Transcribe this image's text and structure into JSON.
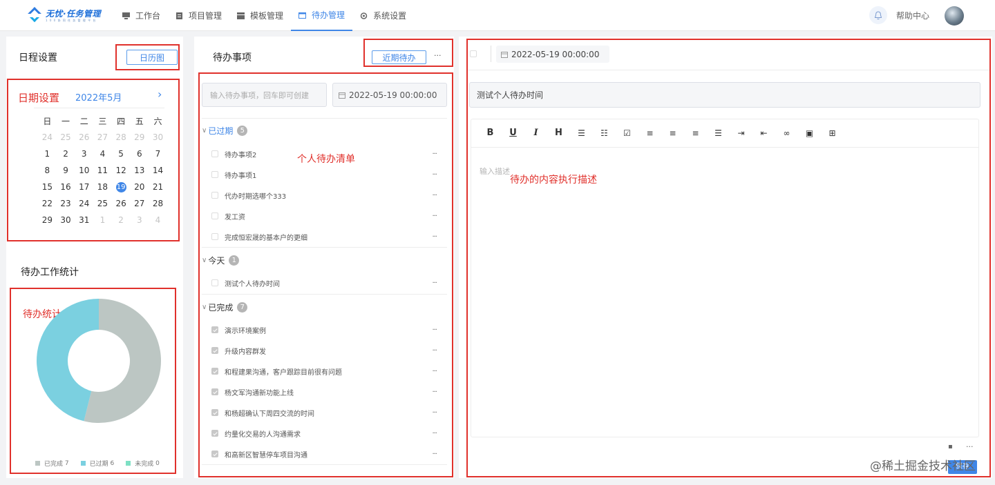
{
  "brand": {
    "title": "无忧·任务管理",
    "subtitle": "1 0 0 协 同 任 务 管 理 平 台"
  },
  "nav": {
    "items": [
      {
        "label": "工作台"
      },
      {
        "label": "项目管理"
      },
      {
        "label": "模板管理"
      },
      {
        "label": "待办管理",
        "active": true
      },
      {
        "label": "系统设置"
      }
    ]
  },
  "header": {
    "help": "帮助中心"
  },
  "schedule": {
    "title": "日程设置",
    "calendar_btn": "日历图",
    "annotation": "日期设置",
    "month": "2022年5月",
    "weekdays": [
      "日",
      "一",
      "二",
      "三",
      "四",
      "五",
      "六"
    ],
    "weeks": [
      [
        "24",
        "25",
        "26",
        "27",
        "28",
        "29",
        "30"
      ],
      [
        "1",
        "2",
        "3",
        "4",
        "5",
        "6",
        "7"
      ],
      [
        "8",
        "9",
        "10",
        "11",
        "12",
        "13",
        "14"
      ],
      [
        "15",
        "16",
        "17",
        "18",
        "19",
        "20",
        "21"
      ],
      [
        "22",
        "23",
        "24",
        "25",
        "26",
        "27",
        "28"
      ],
      [
        "29",
        "30",
        "31",
        "1",
        "2",
        "3",
        "4"
      ]
    ],
    "today": "19"
  },
  "stats": {
    "title": "待办工作统计",
    "annotation": "待办统计",
    "legend": [
      {
        "label": "已完成",
        "count": "7",
        "color": "#bcc6c3"
      },
      {
        "label": "已过期",
        "count": "6",
        "color": "#7bd0e0"
      },
      {
        "label": "未完成",
        "count": "0",
        "color": "#7ee0c4"
      }
    ]
  },
  "chart_data": {
    "type": "pie",
    "donut": true,
    "categories": [
      "已完成",
      "已过期",
      "未完成"
    ],
    "values": [
      7,
      6,
      0
    ],
    "colors": [
      "#bcc6c3",
      "#7bd0e0",
      "#7ee0c4"
    ],
    "legend": "bottom"
  },
  "todo": {
    "title": "待办事项",
    "recent_btn": "近期待办",
    "more": "···",
    "annotation": "个人待办清单",
    "input_placeholder": "输入待办事项，回车即可创建",
    "date_value": "2022-05-19 00:00:00",
    "groups": [
      {
        "name": "已过期",
        "count": "5",
        "items": [
          "待办事项2",
          "待办事项1",
          "代办时期选哪个333",
          "发工资",
          "完成恒宏晟的基本户的更细"
        ]
      },
      {
        "name": "今天",
        "count": "1",
        "items": [
          "测试个人待办时间"
        ]
      },
      {
        "name": "已完成",
        "count": "7",
        "items": [
          "演示环境案例",
          "升级内容群发",
          "和程建果沟通，客户跟踪目前很有问题",
          "杨文军沟通新功能上线",
          "和杨超确认下周四交流的时间",
          "约量化交易的人沟通需求",
          "和高新区智慧停车项目沟通"
        ]
      }
    ]
  },
  "detail": {
    "date_value": "2022-05-19 00:00:00",
    "title_value": "测试个人待办时间",
    "desc_placeholder": "输入描述",
    "annotation": "待办的内容执行描述",
    "toolbar": [
      "B",
      "U",
      "I",
      "H",
      "bullet-list",
      "ordered-list",
      "task-list",
      "align-left",
      "align-center",
      "align-right",
      "align-justify",
      "indent",
      "outdent",
      "link",
      "image",
      "table"
    ],
    "save": "保存"
  },
  "watermark": "@稀土掘金技术社区"
}
